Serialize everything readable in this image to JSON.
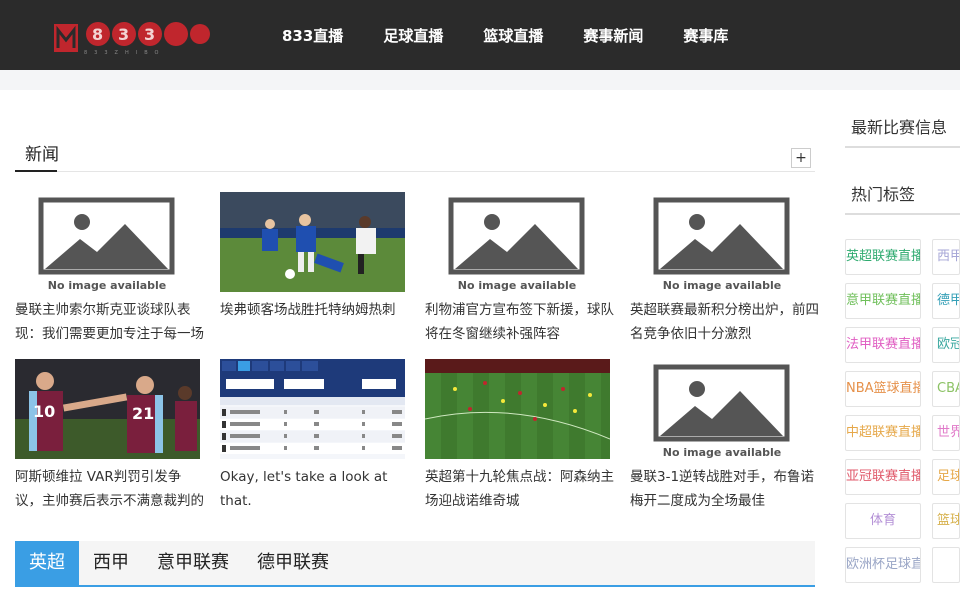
{
  "header": {
    "logo_text": "833直播",
    "nav": [
      "833直播",
      "足球直播",
      "篮球直播",
      "赛事新闻",
      "赛事库"
    ]
  },
  "section": {
    "title": "新闻",
    "plus_label": "+"
  },
  "articles": [
    {
      "title": "曼联主帅索尔斯克亚谈球队表现：我们需要更加专注于每一场比赛的细节",
      "image": "no-image-available"
    },
    {
      "title": "埃弗顿客场战胜托特纳姆热刺",
      "image": "football-photo-blue-vs-white"
    },
    {
      "title": "利物浦官方宣布签下新援，球队将在冬窗继续补强阵容",
      "image": "no-image-available"
    },
    {
      "title": "英超联赛最新积分榜出炉，前四名竞争依旧十分激烈",
      "image": "no-image-available"
    },
    {
      "title": "阿斯顿维拉 VAR判罚引发争议，主帅赛后表示不满意裁判的决定",
      "image": "football-photo-claret-celebration"
    },
    {
      "title": "Okay, let's take a look at that.",
      "image": "stats-table-screenshot"
    },
    {
      "title": "英超第十九轮焦点战：阿森纳主场迎战诺维奇城",
      "image": "football-photo-pitch-wide"
    },
    {
      "title": "曼联3-1逆转战胜对手，布鲁诺梅开二度成为全场最佳",
      "image": "no-image-available"
    }
  ],
  "no_image_label": "No image available",
  "tabs": {
    "items": [
      "英超",
      "西甲",
      "意甲联赛",
      "德甲联赛"
    ],
    "active": 0
  },
  "sidebar": {
    "box1_title": "最新比赛信息",
    "box2_title": "热门标签",
    "tags": [
      {
        "label": "英超联赛直播",
        "color": "#2eaa6f"
      },
      {
        "label": "西甲联赛直播",
        "color": "#a6a6d6"
      },
      {
        "label": "意甲联赛直播在线",
        "color": "#6fbf5a"
      },
      {
        "label": "德甲联赛",
        "color": "#36a0b7"
      },
      {
        "label": "法甲联赛直播",
        "color": "#e05ec2"
      },
      {
        "label": "欧冠直播",
        "color": "#3aa8a0"
      },
      {
        "label": "NBA篮球直播在线",
        "color": "#e6914a"
      },
      {
        "label": "CBA直播",
        "color": "#8cc265"
      },
      {
        "label": "中超联赛直播在线",
        "color": "#e6a84a"
      },
      {
        "label": "世界杯",
        "color": "#e07ac9"
      },
      {
        "label": "亚冠联赛直播在线",
        "color": "#e05a6b"
      },
      {
        "label": "足球直播",
        "color": "#e6a84a"
      },
      {
        "label": "体育",
        "color": "#b38fd6"
      },
      {
        "label": "篮球",
        "color": "#d6b04a"
      },
      {
        "label": "欧洲杯足球直播在线",
        "color": "#9aa6c6"
      },
      {
        "label": "",
        "color": "#cccccc"
      }
    ]
  },
  "colors": {
    "header_bg": "#2b2b2b",
    "accent": "#3a9ee4"
  }
}
